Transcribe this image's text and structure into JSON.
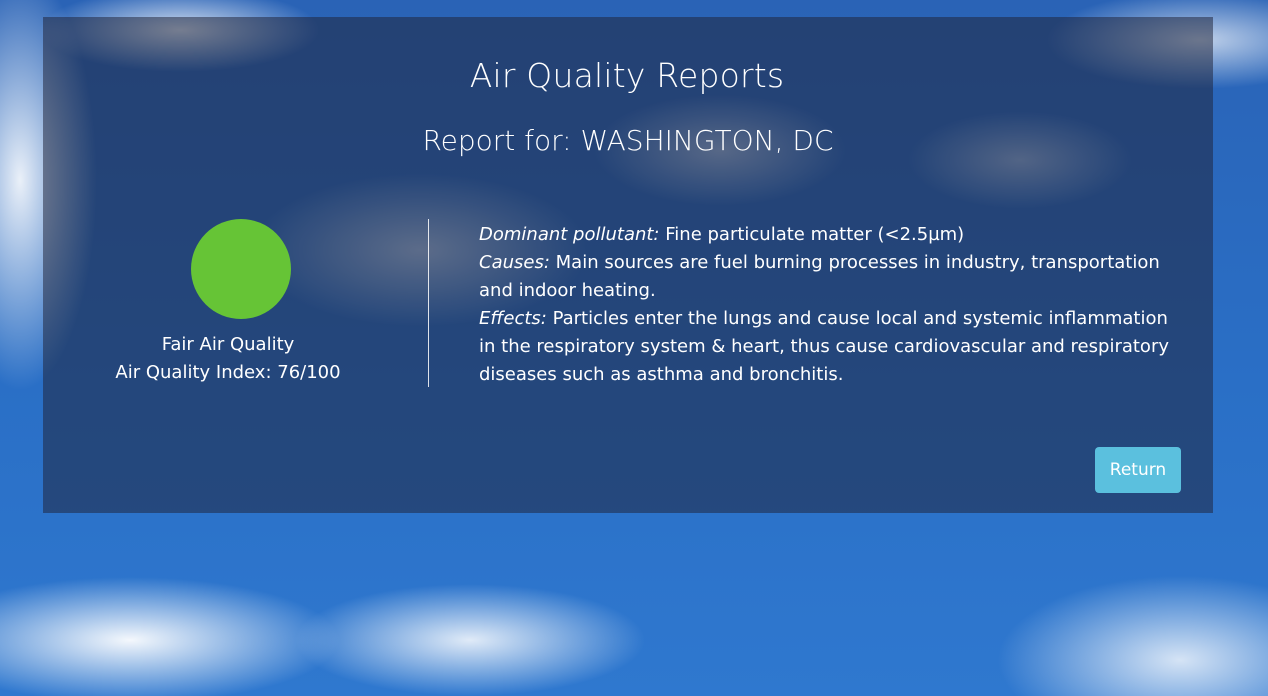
{
  "page": {
    "title": "Air Quality Reports",
    "report_prefix": "Report for: ",
    "city": "WASHINGTON, DC"
  },
  "summary": {
    "indicator_color": "#66c436",
    "quality_label": "Fair Air Quality",
    "index_label": "Air Quality Index: 76/100"
  },
  "details": {
    "dominant_pollutant_label": "Dominant pollutant:",
    "dominant_pollutant_value": " Fine particulate matter (<2.5µm)",
    "causes_label": "Causes:",
    "causes_value": " Main sources are fuel burning processes in industry, transportation and indoor heating.",
    "effects_label": "Effects:",
    "effects_value": " Particles enter the lungs and cause local and systemic inflammation in the respiratory system & heart, thus cause cardiovascular and respiratory diseases such as asthma and bronchitis."
  },
  "actions": {
    "return_label": "Return",
    "return_color": "#5bc0de"
  }
}
